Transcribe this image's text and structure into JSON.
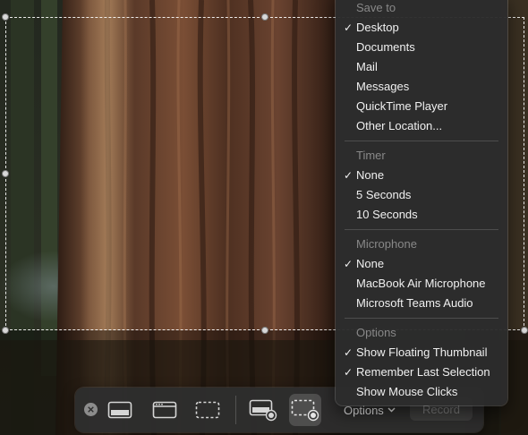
{
  "menu": {
    "sections": [
      {
        "header": "Save to",
        "items": [
          {
            "label": "Desktop",
            "checked": true
          },
          {
            "label": "Documents",
            "checked": false
          },
          {
            "label": "Mail",
            "checked": false
          },
          {
            "label": "Messages",
            "checked": false
          },
          {
            "label": "QuickTime Player",
            "checked": false
          },
          {
            "label": "Other Location...",
            "checked": false
          }
        ]
      },
      {
        "header": "Timer",
        "items": [
          {
            "label": "None",
            "checked": true
          },
          {
            "label": "5 Seconds",
            "checked": false
          },
          {
            "label": "10 Seconds",
            "checked": false
          }
        ]
      },
      {
        "header": "Microphone",
        "items": [
          {
            "label": "None",
            "checked": true
          },
          {
            "label": "MacBook Air Microphone",
            "checked": false
          },
          {
            "label": "Microsoft Teams Audio",
            "checked": false
          }
        ]
      },
      {
        "header": "Options",
        "items": [
          {
            "label": "Show Floating Thumbnail",
            "checked": true
          },
          {
            "label": "Remember Last Selection",
            "checked": true
          },
          {
            "label": "Show Mouse Clicks",
            "checked": false
          }
        ]
      }
    ],
    "check_glyph": "✓"
  },
  "toolbar": {
    "options_label": "Options",
    "record_label": "Record",
    "tools": [
      {
        "icon": "close-icon",
        "active": false
      },
      {
        "icon": "capture-entire-screen-icon",
        "active": false
      },
      {
        "icon": "capture-window-icon",
        "active": false
      },
      {
        "icon": "capture-selection-icon",
        "active": false
      },
      {
        "icon": "record-entire-screen-icon",
        "active": false
      },
      {
        "icon": "record-selection-icon",
        "active": true
      }
    ]
  }
}
